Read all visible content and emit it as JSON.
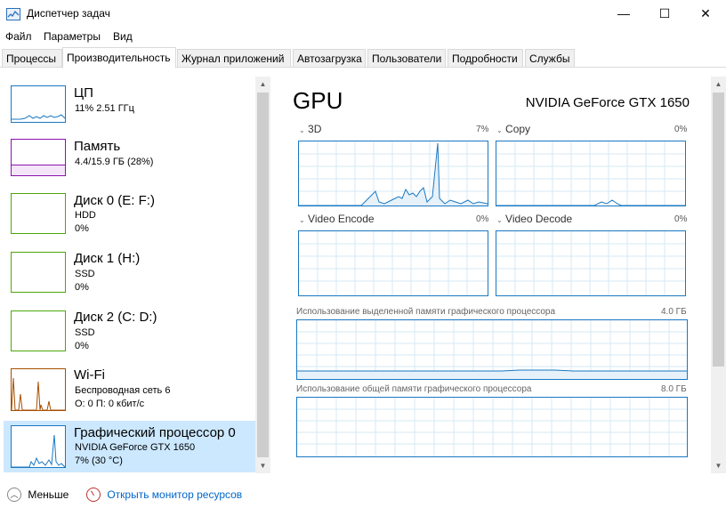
{
  "window": {
    "title": "Диспетчер задач",
    "minimize_glyph": "—",
    "maximize_glyph": "☐",
    "close_glyph": "✕"
  },
  "menu": [
    "Файл",
    "Параметры",
    "Вид"
  ],
  "tabs": [
    "Процессы",
    "Производительность",
    "Журнал приложений",
    "Автозагрузка",
    "Пользователи",
    "Подробности",
    "Службы"
  ],
  "active_tab": "Производительность",
  "sidebar": {
    "items": [
      {
        "title": "ЦП",
        "line1": "11% 2.51 ГГц",
        "line2": "",
        "color": "#1a78c2",
        "selected": false
      },
      {
        "title": "Память",
        "line1": "4.4/15.9 ГБ (28%)",
        "line2": "",
        "color": "#8b12ae",
        "selected": false
      },
      {
        "title": "Диск 0 (E: F:)",
        "line1": "HDD",
        "line2": "0%",
        "color": "#4da60c",
        "selected": false
      },
      {
        "title": "Диск 1 (H:)",
        "line1": "SSD",
        "line2": "0%",
        "color": "#4da60c",
        "selected": false
      },
      {
        "title": "Диск 2 (C: D:)",
        "line1": "SSD",
        "line2": "0%",
        "color": "#4da60c",
        "selected": false
      },
      {
        "title": "Wi-Fi",
        "line1": "Беспроводная сеть 6",
        "line2": "О: 0 П: 0 кбит/с",
        "color": "#a74f01",
        "selected": false
      },
      {
        "title": "Графический процессор 0",
        "line1": "NVIDIA GeForce GTX 1650",
        "line2": "7% (30 °C)",
        "color": "#1a78c2",
        "selected": true
      }
    ]
  },
  "gpu": {
    "heading": "GPU",
    "model": "NVIDIA GeForce GTX 1650",
    "engines": [
      {
        "name": "3D",
        "percent": "7%"
      },
      {
        "name": "Copy",
        "percent": "0%"
      },
      {
        "name": "Video Encode",
        "percent": "0%"
      },
      {
        "name": "Video Decode",
        "percent": "0%"
      }
    ],
    "dedicated_memory": {
      "label": "Использование выделенной памяти графического процессора",
      "max": "4.0 ГБ"
    },
    "shared_memory": {
      "label": "Использование общей памяти графического процессора",
      "max": "8.0 ГБ"
    },
    "accent_color": "#1a78c2"
  },
  "footer": {
    "less_label": "Меньше",
    "monitor_label": "Открыть монитор ресурсов",
    "link_color": "#0066cc"
  }
}
